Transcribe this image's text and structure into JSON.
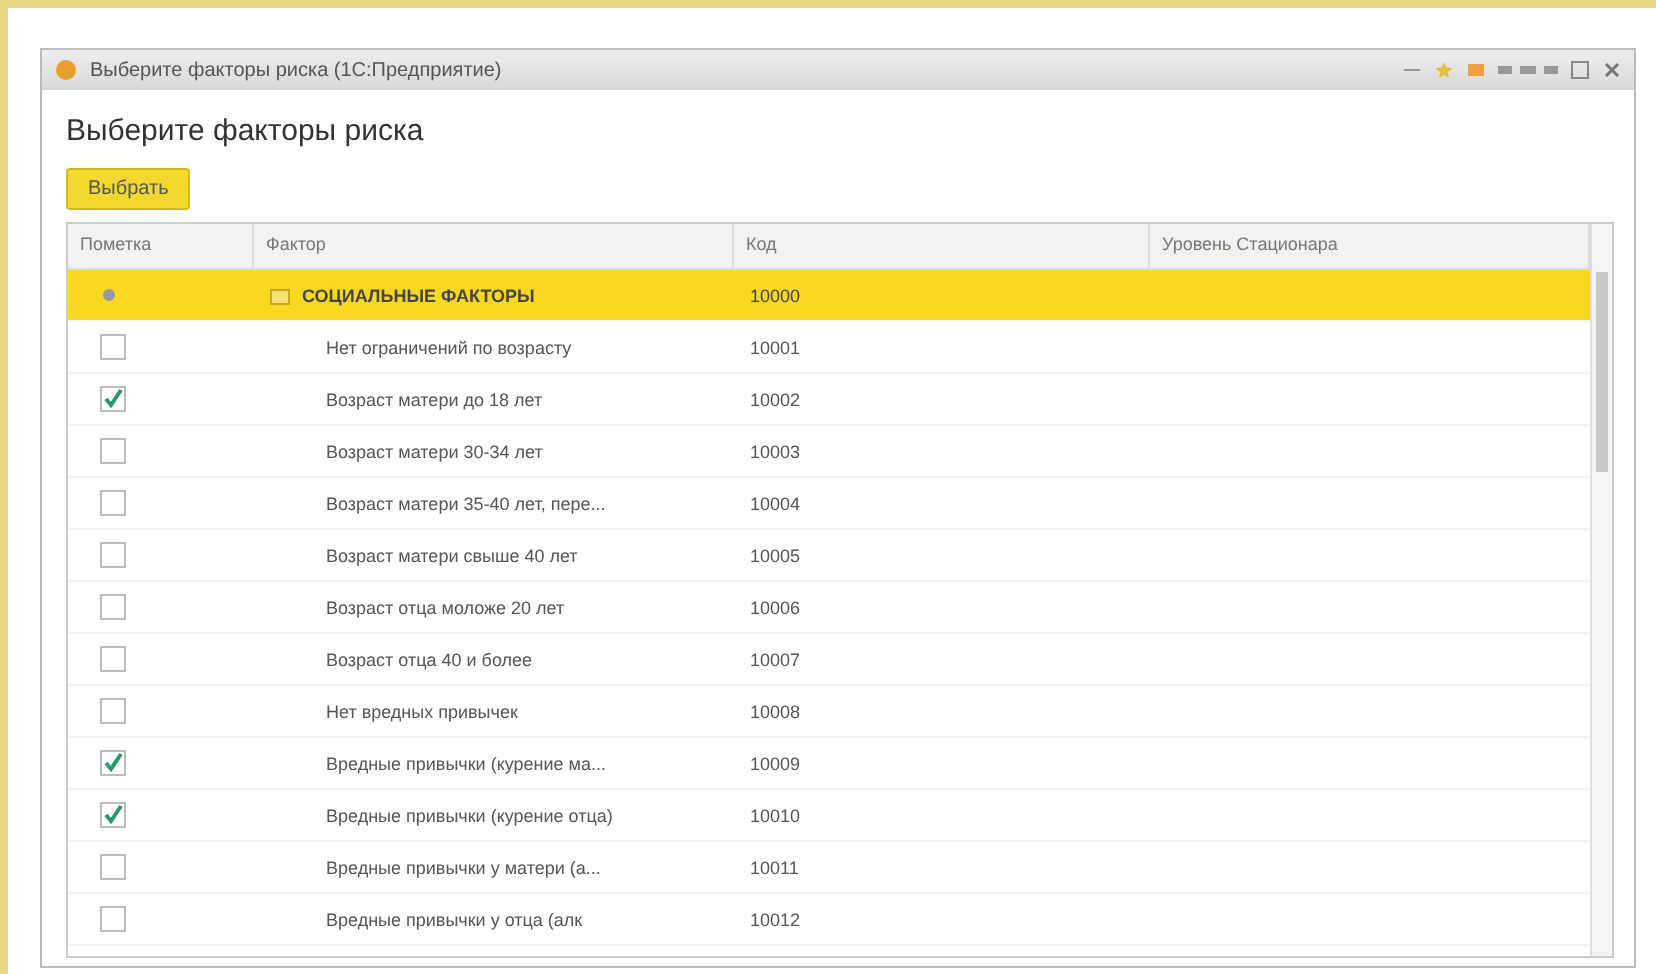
{
  "window": {
    "title": "Выберите факторы риска (1С:Предприятие)"
  },
  "heading": "Выберите факторы риска",
  "buttons": [
    {
      "label": "Выбрать"
    }
  ],
  "table": {
    "columns": [
      "Пометка",
      "Фактор",
      "Код",
      "Уровень Стационара"
    ],
    "rows": [
      {
        "kind": "group",
        "selected": true,
        "factor": "СОЦИАЛЬНЫЕ ФАКТОРЫ",
        "code": "10000"
      },
      {
        "kind": "item",
        "selected": false,
        "checked": false,
        "factor": "Нет ограничений по возрасту",
        "code": "10001"
      },
      {
        "kind": "item",
        "selected": false,
        "checked": true,
        "factor": "Возраст матери до 18 лет",
        "code": "10002"
      },
      {
        "kind": "item",
        "selected": false,
        "checked": false,
        "factor": "Возраст матери 30-34 лет",
        "code": "10003"
      },
      {
        "kind": "item",
        "selected": false,
        "checked": false,
        "factor": "Возраст матери 35-40 лет, пере...",
        "code": "10004"
      },
      {
        "kind": "item",
        "selected": false,
        "checked": false,
        "factor": "Возраст матери свыше 40 лет",
        "code": "10005"
      },
      {
        "kind": "item",
        "selected": false,
        "checked": false,
        "factor": "Возраст отца моложе 20 лет",
        "code": "10006"
      },
      {
        "kind": "item",
        "selected": false,
        "checked": false,
        "factor": "Возраст отца 40 и более",
        "code": "10007"
      },
      {
        "kind": "item",
        "selected": false,
        "checked": false,
        "factor": "Нет вредных привычек",
        "code": "10008"
      },
      {
        "kind": "item",
        "selected": false,
        "checked": true,
        "factor": "Вредные привычки (курение ма...",
        "code": "10009"
      },
      {
        "kind": "item",
        "selected": false,
        "checked": true,
        "factor": "Вредные привычки (курение отца)",
        "code": "10010"
      },
      {
        "kind": "item",
        "selected": false,
        "checked": false,
        "factor": "Вредные привычки у матери (а...",
        "code": "10011"
      },
      {
        "kind": "item",
        "selected": false,
        "checked": false,
        "factor": "Вредные привычки у отца (алк",
        "code": "10012"
      }
    ]
  }
}
